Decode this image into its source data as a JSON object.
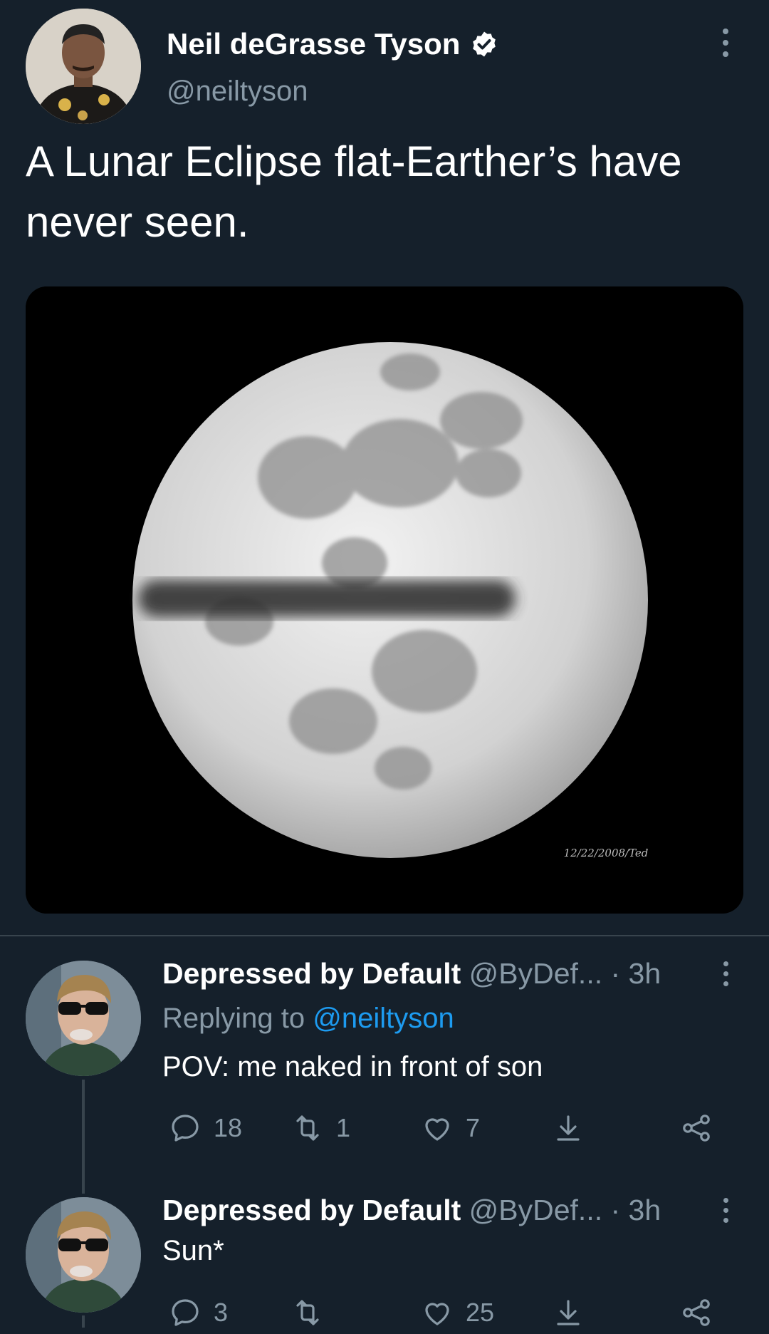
{
  "tweet": {
    "author_name": "Neil deGrasse Tyson",
    "handle": "@neiltyson",
    "text": "A Lunar Eclipse flat-Earther’s have never seen.",
    "media_caption": "12/22/2008/Ted",
    "icons": [
      "verified-badge-icon",
      "more-icon"
    ]
  },
  "replies": [
    {
      "author_name": "Depressed by Default",
      "handle_time": "@ByDef... · 3h",
      "replying_label": "Replying to",
      "replying_mention": "@neiltyson",
      "text": "POV: me naked in front of son",
      "reply_count": "18",
      "retweet_count": "1",
      "like_count": "7"
    },
    {
      "author_name": "Depressed by Default",
      "handle_time": "@ByDef... · 3h",
      "text": "Sun*",
      "reply_count": "3",
      "retweet_count": "",
      "like_count": "25"
    }
  ],
  "colors": {
    "background": "#15202b",
    "secondary_text": "#8899a6",
    "link": "#1d9bf0",
    "divider": "#38444d"
  }
}
